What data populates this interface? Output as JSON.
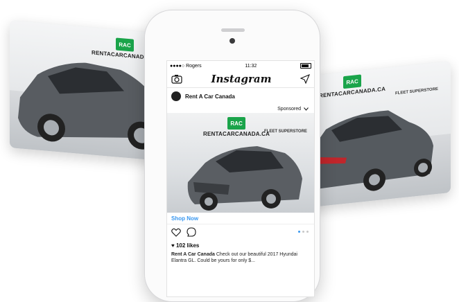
{
  "brand": {
    "logo_badge": "RAC",
    "logo_text": "RENTACARCANADA.CA",
    "fleet_text": "FLEET SUPERSTORE",
    "green": "#1aa44a"
  },
  "status_bar": {
    "carrier": "●●●●○ Rogers",
    "time": "11:32"
  },
  "nav": {
    "title": "Instagram",
    "camera_icon": "camera-icon",
    "direct_icon": "paper-plane-icon"
  },
  "post": {
    "account": "Rent A Car Canada",
    "sponsored": "Sponsored",
    "cta": "Shop Now",
    "likes": "102 likes",
    "caption_user": "Rent A Car Canada",
    "caption_text": "Check out our beautiful 2017 Hyundai Elantra GL. Could be yours for only $..."
  },
  "colors": {
    "link_blue": "#3897f0",
    "car_gray": "#5a5e63"
  }
}
